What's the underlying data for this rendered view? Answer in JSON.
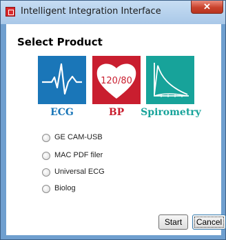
{
  "window": {
    "title": "Intelligent Integration Interface",
    "close_label": "✕"
  },
  "main": {
    "heading": "Select Product",
    "products": [
      {
        "label": "ECG",
        "color": "#1a76b8",
        "icon": "ecg-waveform-icon"
      },
      {
        "label": "BP",
        "color": "#c91e2f",
        "icon": "heart-pressure-icon",
        "icon_text": "120/80"
      },
      {
        "label": "Spirometry",
        "color": "#17a39a",
        "icon": "spirometry-curve-icon"
      }
    ],
    "options": [
      {
        "label": "GE CAM-USB",
        "selected": false
      },
      {
        "label": "MAC PDF filer",
        "selected": false
      },
      {
        "label": "Universal ECG",
        "selected": false
      },
      {
        "label": "Biolog",
        "selected": false
      }
    ],
    "start_label": "Start",
    "cancel_label": "Cancel"
  },
  "colors": {
    "ecg_tile": "#1a76b8",
    "bp_tile": "#c91e2f",
    "spiro_tile": "#17a39a",
    "titlebar": "#b9d4ee",
    "close_button": "#c9422d"
  }
}
